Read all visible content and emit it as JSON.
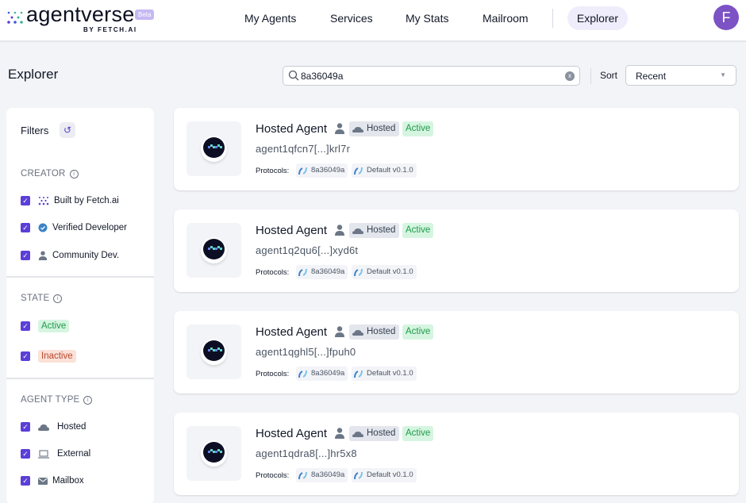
{
  "brand": {
    "name": "agentverse",
    "badge": "Beta",
    "byline": "BY FETCH.AI"
  },
  "nav": {
    "items": [
      {
        "label": "My Agents",
        "active": false
      },
      {
        "label": "Services",
        "active": false
      },
      {
        "label": "My Stats",
        "active": false
      },
      {
        "label": "Mailroom",
        "active": false
      },
      {
        "label": "Explorer",
        "active": true
      }
    ],
    "avatar_initial": "F"
  },
  "page": {
    "title": "Explorer"
  },
  "search": {
    "value": "8a36049a",
    "clear_icon": "x"
  },
  "sort": {
    "label": "Sort",
    "selected": "Recent"
  },
  "filters": {
    "title": "Filters",
    "reset_icon": "↺",
    "creator": {
      "title": "CREATOR",
      "items": [
        {
          "label": "Built by Fetch.ai",
          "icon": "fetch-dots-icon",
          "checked": true
        },
        {
          "label": "Verified Developer",
          "icon": "verified-badge-icon",
          "checked": true
        },
        {
          "label": "Community Dev.",
          "icon": "user-icon",
          "checked": true
        }
      ]
    },
    "state": {
      "title": "STATE",
      "items": [
        {
          "label": "Active",
          "checked": true
        },
        {
          "label": "Inactive",
          "checked": true
        }
      ]
    },
    "agent_type": {
      "title": "AGENT TYPE",
      "items": [
        {
          "label": "Hosted",
          "icon": "cloud-icon",
          "checked": true
        },
        {
          "label": "External",
          "icon": "laptop-icon",
          "checked": true
        },
        {
          "label": "Mailbox",
          "icon": "mail-icon",
          "checked": true
        }
      ]
    }
  },
  "agents": [
    {
      "name": "Hosted Agent",
      "type": "Hosted",
      "status": "Active",
      "address": "agent1qfcn7[...]krl7r",
      "protocols_label": "Protocols:",
      "protocols": [
        "8a36049a",
        "Default v0.1.0"
      ]
    },
    {
      "name": "Hosted Agent",
      "type": "Hosted",
      "status": "Active",
      "address": "agent1q2qu6[...]xyd6t",
      "protocols_label": "Protocols:",
      "protocols": [
        "8a36049a",
        "Default v0.1.0"
      ]
    },
    {
      "name": "Hosted Agent",
      "type": "Hosted",
      "status": "Active",
      "address": "agent1qghl5[...]fpuh0",
      "protocols_label": "Protocols:",
      "protocols": [
        "8a36049a",
        "Default v0.1.0"
      ]
    },
    {
      "name": "Hosted Agent",
      "type": "Hosted",
      "status": "Active",
      "address": "agent1qdra8[...]hr5x8",
      "protocols_label": "Protocols:",
      "protocols": [
        "8a36049a",
        "Default v0.1.0"
      ]
    }
  ],
  "colors": {
    "accent": "#5b3fd8",
    "avatar": "#7c52c4",
    "active_bg": "#d6f5e1",
    "active_fg": "#1f9a48",
    "inactive_bg": "#fbe1d8",
    "inactive_fg": "#b8472a"
  }
}
